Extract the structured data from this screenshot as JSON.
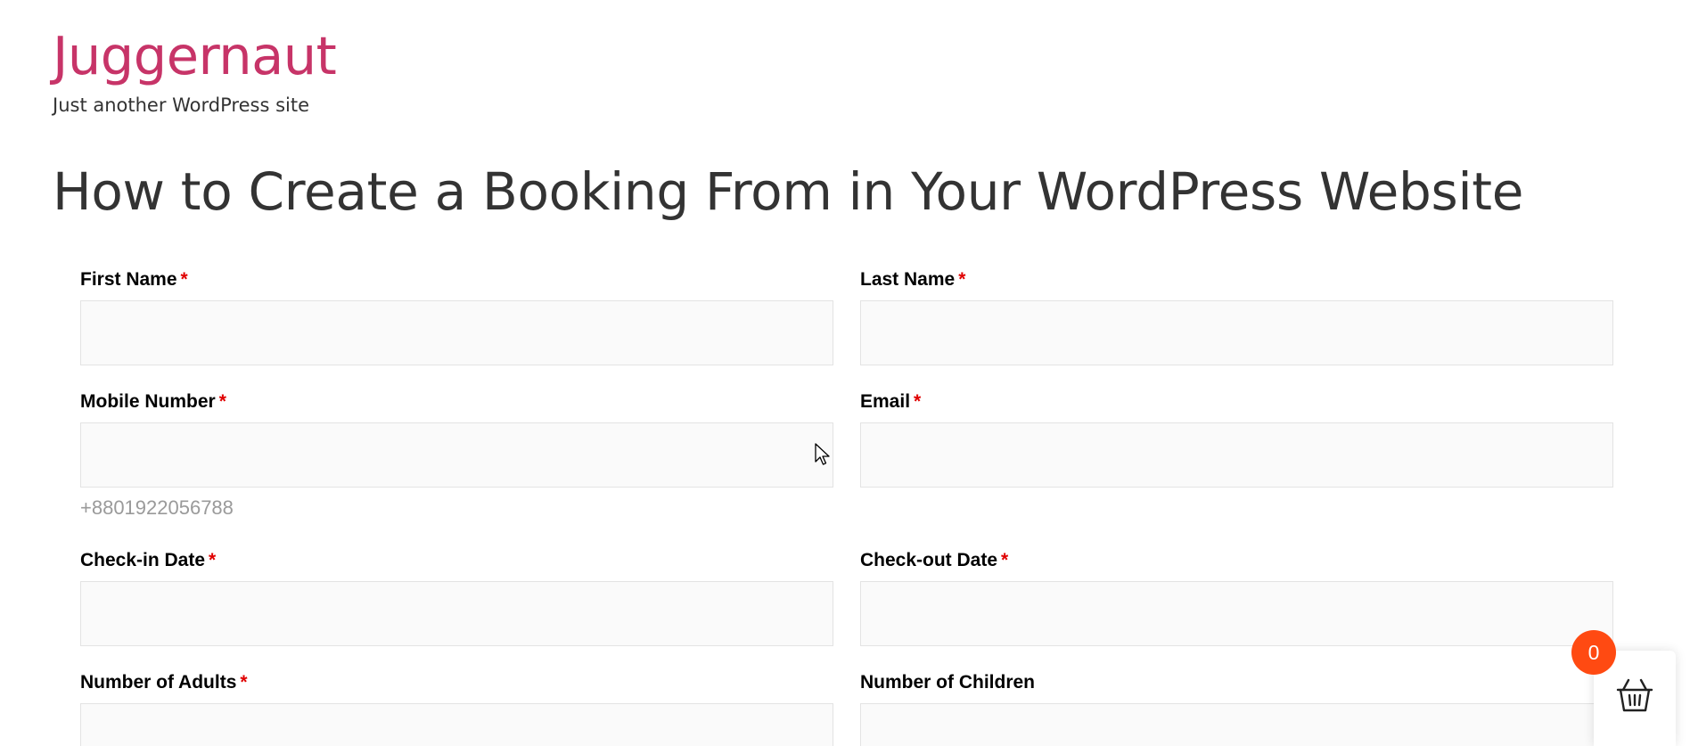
{
  "site": {
    "title": "Juggernaut",
    "tagline": "Just another WordPress site"
  },
  "page": {
    "title": "How to Create a Booking From in Your WordPress Website"
  },
  "form": {
    "required_mark": "*",
    "fields": {
      "first_name": {
        "label": "First Name",
        "value": ""
      },
      "last_name": {
        "label": "Last Name",
        "value": ""
      },
      "mobile_number": {
        "label": "Mobile Number",
        "value": "",
        "help": "+8801922056788"
      },
      "email": {
        "label": "Email",
        "value": ""
      },
      "check_in": {
        "label": "Check-in Date",
        "value": ""
      },
      "check_out": {
        "label": "Check-out Date",
        "value": ""
      },
      "adults": {
        "label": "Number of Adults",
        "value": ""
      },
      "children": {
        "label": "Number of Children",
        "value": ""
      }
    }
  },
  "cart": {
    "count": "0",
    "icon": "basket-icon"
  },
  "colors": {
    "site_title": "#c73468",
    "required": "#e00000",
    "badge": "#ff4a12",
    "input_bg": "#fafafa"
  }
}
